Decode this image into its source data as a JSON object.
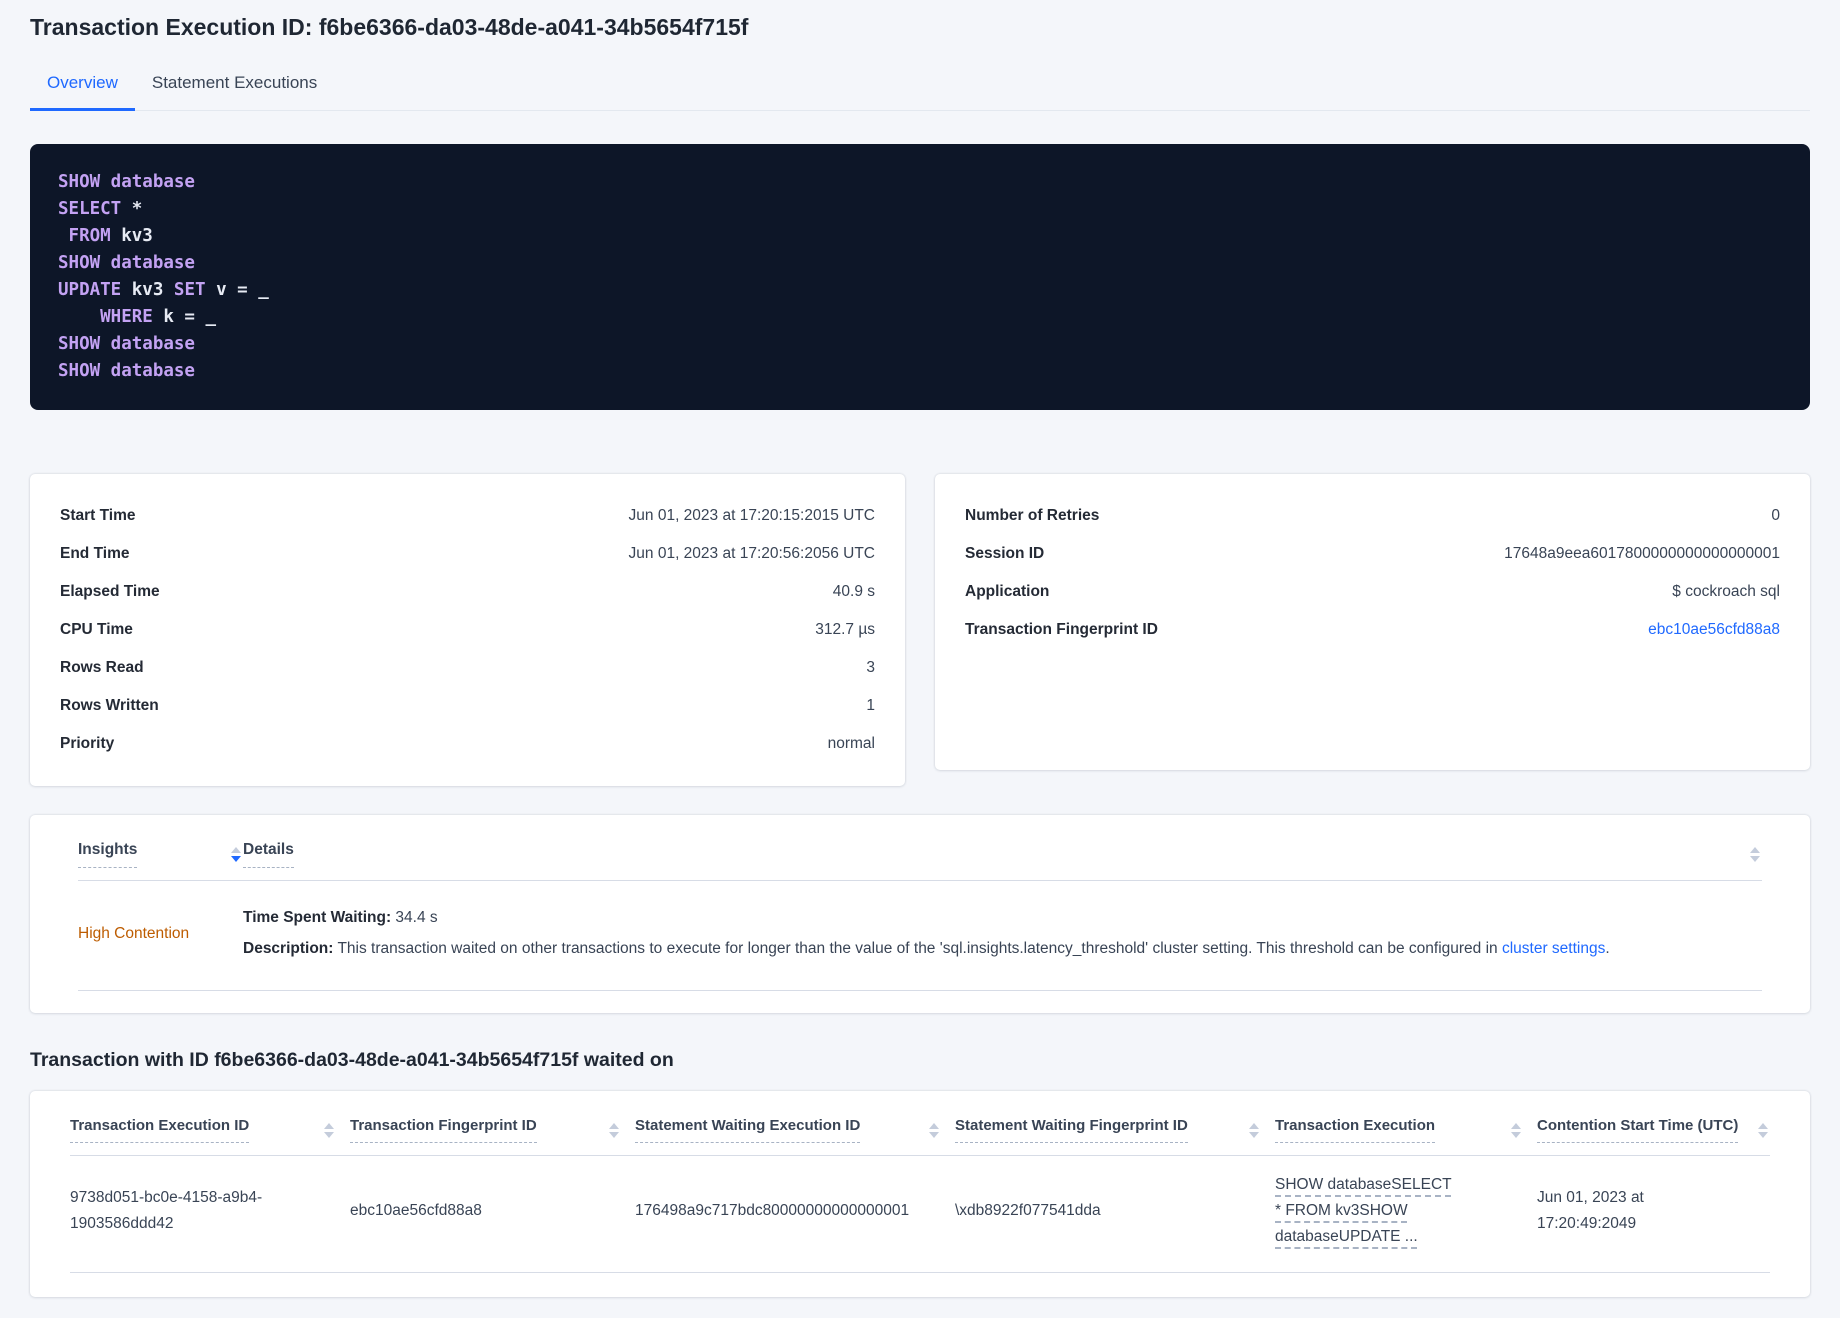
{
  "header": {
    "title": "Transaction Execution ID: f6be6366-da03-48de-a041-34b5654f715f"
  },
  "tabs": [
    {
      "label": "Overview",
      "active": true
    },
    {
      "label": "Statement Executions",
      "active": false
    }
  ],
  "sql_box": {
    "lines": [
      [
        {
          "text": "SHOW database",
          "type": "keyword"
        }
      ],
      [
        {
          "text": "SELECT ",
          "type": "keyword"
        },
        {
          "text": "*",
          "type": "plain"
        }
      ],
      [
        {
          "text": " FROM ",
          "type": "keyword"
        },
        {
          "text": "kv3",
          "type": "plain"
        }
      ],
      [
        {
          "text": "SHOW database",
          "type": "keyword"
        }
      ],
      [
        {
          "text": "UPDATE ",
          "type": "keyword"
        },
        {
          "text": "kv3 ",
          "type": "plain"
        },
        {
          "text": "SET ",
          "type": "keyword"
        },
        {
          "text": "v = _",
          "type": "plain"
        }
      ],
      [
        {
          "text": "    WHERE ",
          "type": "keyword"
        },
        {
          "text": "k = _",
          "type": "plain"
        }
      ],
      [
        {
          "text": "SHOW database",
          "type": "keyword"
        }
      ],
      [
        {
          "text": "SHOW database",
          "type": "keyword"
        }
      ]
    ]
  },
  "overview": {
    "left": {
      "rows": [
        {
          "label": "Start Time",
          "value": "Jun 01, 2023 at 17:20:15:2015 UTC"
        },
        {
          "label": "End Time",
          "value": "Jun 01, 2023 at 17:20:56:2056 UTC"
        },
        {
          "label": "Elapsed Time",
          "value": "40.9 s"
        },
        {
          "label": "CPU Time",
          "value": "312.7 µs"
        },
        {
          "label": "Rows Read",
          "value": "3"
        },
        {
          "label": "Rows Written",
          "value": "1"
        },
        {
          "label": "Priority",
          "value": "normal"
        }
      ]
    },
    "right": {
      "rows": [
        {
          "label": "Number of Retries",
          "value": "0"
        },
        {
          "label": "Session ID",
          "value": "17648a9eea6017800000000000000001"
        },
        {
          "label": "Application",
          "value": "$ cockroach sql"
        },
        {
          "label": "Transaction Fingerprint ID",
          "value": "ebc10ae56cfd88a8",
          "link": true
        }
      ]
    }
  },
  "insights_table": {
    "columns": [
      "Insights",
      "Details"
    ],
    "row": {
      "insight": "High Contention",
      "waiting_label": "Time Spent Waiting:",
      "waiting_value": " 34.4 s",
      "desc_label": "Description:",
      "desc_text": " This transaction waited on other transactions to execute for longer than the value of the 'sql.insights.latency_threshold' cluster setting. This threshold can be configured in ",
      "desc_link": "cluster settings",
      "desc_suffix": "."
    }
  },
  "waited_on": {
    "heading": "Transaction with ID f6be6366-da03-48de-a041-34b5654f715f waited on",
    "columns": [
      "Transaction Execution ID",
      "Transaction Fingerprint ID",
      "Statement Waiting Execution ID",
      "Statement Waiting Fingerprint ID",
      "Transaction Execution",
      "Contention Start Time (UTC)"
    ],
    "row": {
      "transaction_execution_id": "9738d051-bc0e-4158-a9b4-1903586ddd42",
      "transaction_fingerprint_id": "ebc10ae56cfd88a8",
      "statement_waiting_execution_id": "176498a9c717bdc80000000000000001",
      "statement_waiting_fingerprint_id": "\\xdb8922f077541dda",
      "transaction_execution": "SHOW databaseSELECT * FROM kv3SHOW databaseUPDATE ...",
      "contention_start_time": "Jun 01, 2023 at 17:20:49:2049"
    }
  },
  "colors": {
    "accent_blue": "#1f69ff",
    "contention_orange": "#bd5c00",
    "sql_keyword": "#c3a2f3",
    "sql_plain": "#e7ebf4",
    "code_background": "#0d1628"
  }
}
